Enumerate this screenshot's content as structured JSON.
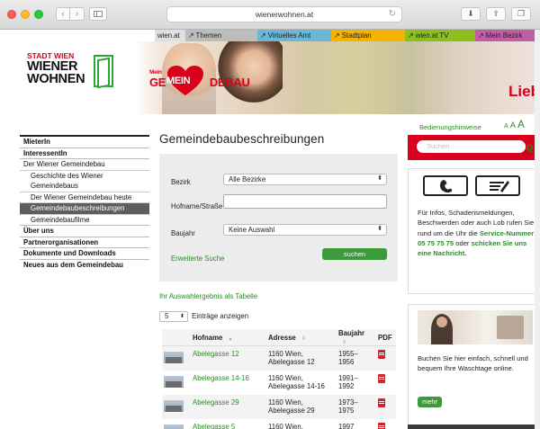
{
  "browser": {
    "url": "wienerwohnen.at"
  },
  "topnav": {
    "wien": "wien.at",
    "themen": "↗ Themen",
    "amt": "↗ Virtuelles Amt",
    "stadtplan": "↗ Stadtplan",
    "tv": "↗ wien.at TV",
    "bezirk": "↗ Mein Bezirk"
  },
  "banner": {
    "logo_line1": "STADT WIEN",
    "logo_line2": "WIENER",
    "logo_line3": "WOHNEN",
    "slogan_mein": "Mein",
    "slogan_ge": "GE",
    "slogan_heart": "MEIN",
    "slogan_debau": "DEBAU",
    "right_text": "Lieb"
  },
  "tools": {
    "bedienungshinweise": "Bedienungshinweise",
    "font_sizes": "A A A"
  },
  "leftnav": {
    "items": [
      {
        "label": "MieterIn",
        "type": "top"
      },
      {
        "label": "InteressentIn",
        "type": "bold"
      },
      {
        "label": "Der Wiener Gemeindebau",
        "type": "plain"
      },
      {
        "label": "Geschichte des Wiener Gemeindebaus",
        "type": "sub"
      },
      {
        "label": "Der Wiener Gemeindebau heute",
        "type": "sub"
      },
      {
        "label": "Gemeindebaubeschreibungen",
        "type": "active"
      },
      {
        "label": "Gemeindebaufilme",
        "type": "sub"
      },
      {
        "label": "Über uns",
        "type": "bold"
      },
      {
        "label": "Partnerorganisationen",
        "type": "bold"
      },
      {
        "label": "Dokumente und Downloads",
        "type": "bold"
      },
      {
        "label": "Neues aus dem Gemeindebau",
        "type": "bold"
      }
    ]
  },
  "main": {
    "title": "Gemeindebaubeschreibungen",
    "form": {
      "bezirk_label": "Bezirk",
      "bezirk_value": "Alle Bezirke",
      "hofname_label": "Hofname/Straße",
      "hofname_value": "",
      "baujahr_label": "Baujahr",
      "baujahr_value": "Keine Auswahl",
      "erweitert": "Erweiterte Suche",
      "submit": "suchen"
    },
    "table_link": "Ihr Auswahlergebnis als Tabelle",
    "entries_value": "5",
    "entries_label": "Einträge anzeigen",
    "columns": [
      "Hofname",
      "Adresse",
      "Baujahr",
      "PDF"
    ],
    "rows": [
      {
        "hofname": "Abelegasse 12",
        "adresse": "1160 Wien, Abelegasse 12",
        "baujahr": "1955–1956"
      },
      {
        "hofname": "Abelegasse 14-16",
        "adresse": "1160 Wien, Abelegasse 14-16",
        "baujahr": "1991–1992"
      },
      {
        "hofname": "Abelegasse 29",
        "adresse": "1160 Wien, Abelegasse 29",
        "baujahr": "1973–1975"
      },
      {
        "hofname": "Abelegasse 5",
        "adresse": "1160 Wien,",
        "baujahr": "1997"
      }
    ]
  },
  "sidebar": {
    "search_placeholder": "Suchen",
    "search_icon": "Q",
    "info_intro": "Für Infos, Schadensmeldungen, Beschwerden oder auch Lob rufen Sie rund um die Uhr die",
    "info_hotline": "Service-Nummer 05 75 75 75",
    "info_or": "oder",
    "info_link": "schicken Sie uns eine Nachricht.",
    "wash_text": "Buchen Sie hier einfach, schnell und bequem Ihre Waschtage online.",
    "mehr": "mehr"
  },
  "colors": {
    "brand_red": "#d9001b",
    "link_green": "#2a8a28",
    "button_green": "#3c9a3a"
  }
}
